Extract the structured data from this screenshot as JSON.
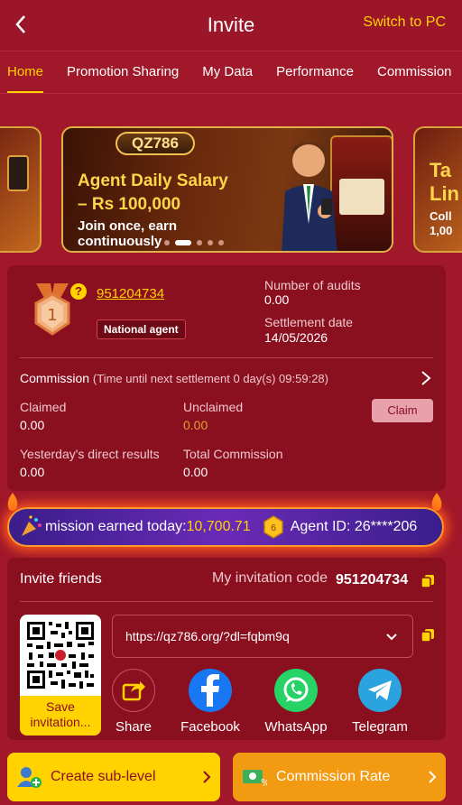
{
  "header": {
    "title": "Invite",
    "switch_label": "Switch to PC"
  },
  "tabs": [
    {
      "label": "Home",
      "active": true
    },
    {
      "label": "Promotion Sharing",
      "active": false
    },
    {
      "label": "My Data",
      "active": false
    },
    {
      "label": "Performance",
      "active": false
    },
    {
      "label": "Commission",
      "active": false
    }
  ],
  "banner": {
    "brand": "QZ786",
    "headline_1": "Agent Daily Salary",
    "headline_2": "– Rs 100,000",
    "subtext": "Join once, earn continuously",
    "right_peek_1": "Ta",
    "right_peek_2": "Lin",
    "right_peek_3": "Coll",
    "right_peek_4": "1,00",
    "active_slide": 1,
    "slide_count": 5
  },
  "agent": {
    "level": "1",
    "id": "951204734",
    "badge": "National agent",
    "audits_label": "Number of audits",
    "audits_value": "0.00",
    "settlement_label": "Settlement date",
    "settlement_value": "14/05/2026"
  },
  "commission": {
    "title": "Commission",
    "countdown": "(Time until next settlement 0 day(s) 09:59:28)",
    "claimed_label": "Claimed",
    "claimed_value": "0.00",
    "unclaimed_label": "Unclaimed",
    "unclaimed_value": "0.00",
    "claim_button": "Claim",
    "yesterday_label": "Yesterday's direct results",
    "yesterday_value": "0.00",
    "total_label": "Total Commission",
    "total_value": "0.00"
  },
  "ticker": {
    "earned_label": "mission earned today:",
    "earned_value": "10,700.71",
    "agent_label": "Agent ID: 26****206"
  },
  "invite": {
    "title": "Invite friends",
    "code_label": "My invitation code",
    "code_value": "951204734",
    "link": "https://qz786.org/?dl=fqbm9q",
    "save_label": "Save invitation..."
  },
  "share": [
    {
      "label": "Share",
      "icon": "share-icon"
    },
    {
      "label": "Facebook",
      "icon": "facebook-icon"
    },
    {
      "label": "WhatsApp",
      "icon": "whatsapp-icon"
    },
    {
      "label": "Telegram",
      "icon": "telegram-icon"
    }
  ],
  "bottom": {
    "sub_level": "Create sub-level",
    "commission_rate": "Commission Rate"
  },
  "colors": {
    "accent": "#ffd200",
    "background": "#a1182a",
    "card": "#8a1020",
    "unclaimed": "#e0a030"
  }
}
